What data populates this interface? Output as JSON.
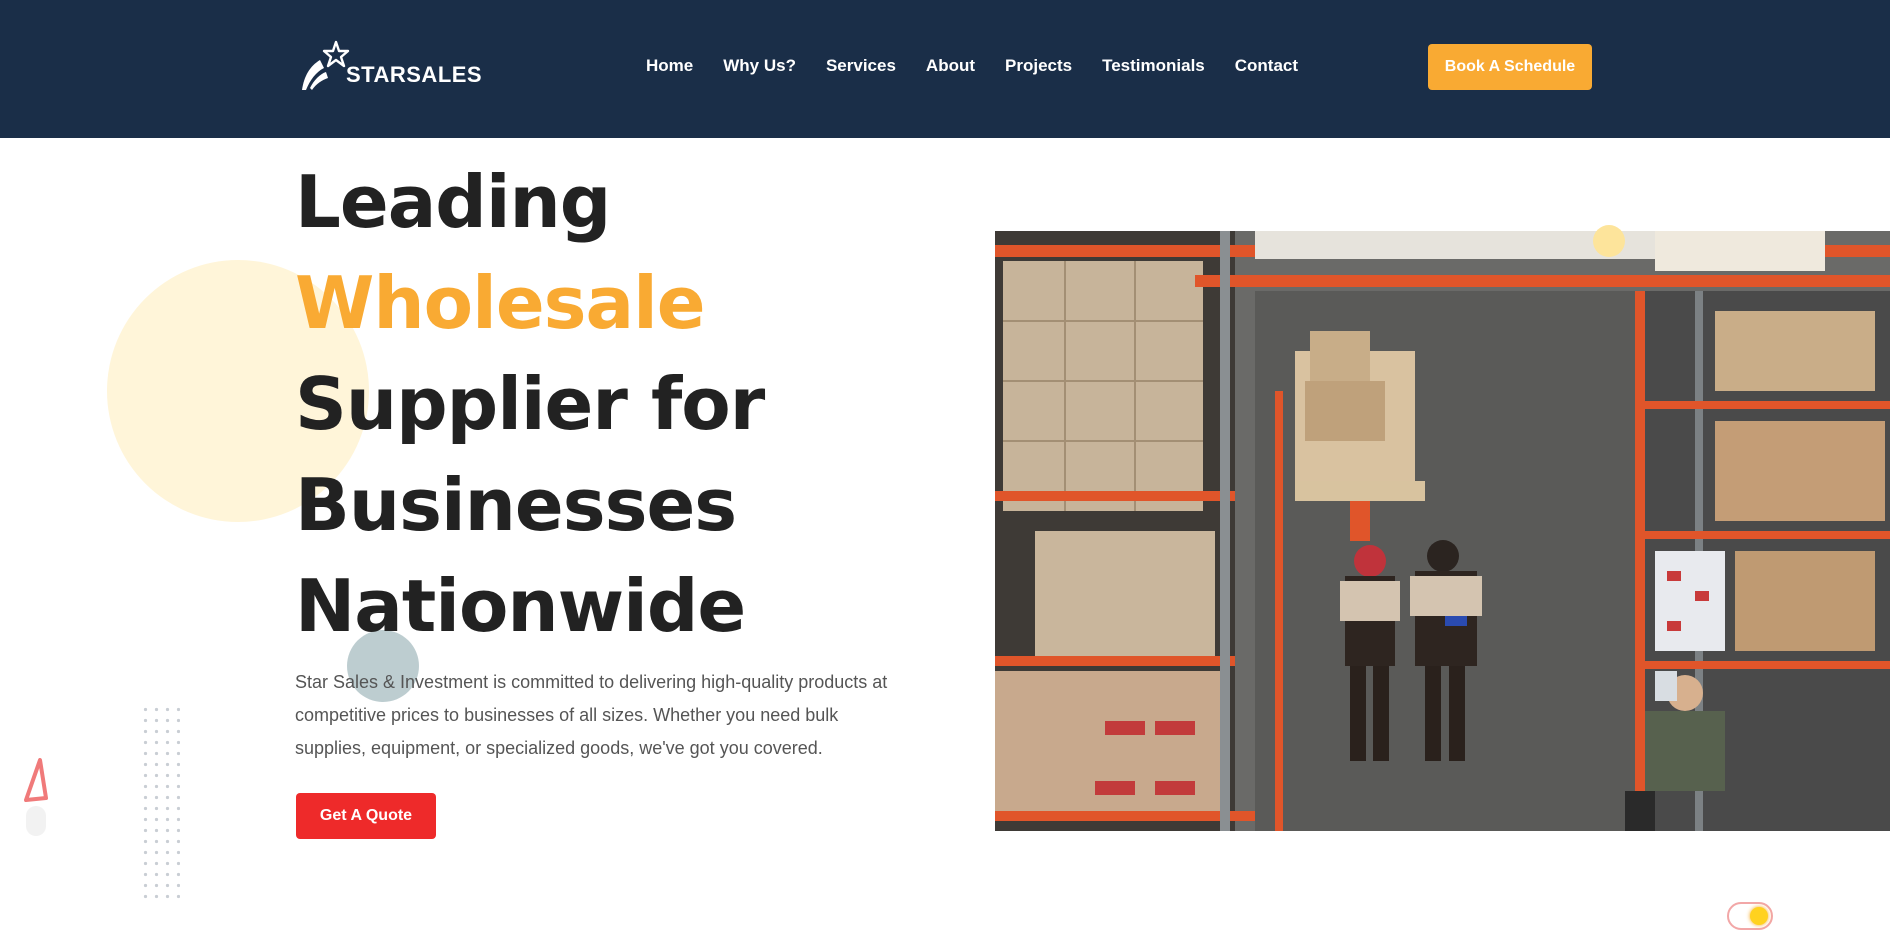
{
  "brand": {
    "name": "STARSALES"
  },
  "nav": {
    "items": [
      {
        "label": "Home"
      },
      {
        "label": "Why Us?"
      },
      {
        "label": "Services"
      },
      {
        "label": "About"
      },
      {
        "label": "Projects"
      },
      {
        "label": "Testimonials"
      },
      {
        "label": "Contact"
      }
    ],
    "cta_label": "Book A Schedule"
  },
  "hero": {
    "title_lines": [
      "Leading",
      "Wholesale",
      "Supplier for",
      "Businesses",
      "Nationwide"
    ],
    "description": "Star Sales & Investment is committed to delivering high-quality products at competitive prices to businesses of all sizes. Whether you need bulk supplies, equipment, or specialized goods, we've got you covered.",
    "cta_label": "Get A Quote"
  },
  "colors": {
    "header_bg": "#1a2e48",
    "accent": "#f9aa33",
    "cta_red": "#ee2a2a",
    "heading": "#222222"
  },
  "icons": {
    "logo": "shooting-star-icon",
    "theme_toggle": "sun-icon"
  }
}
